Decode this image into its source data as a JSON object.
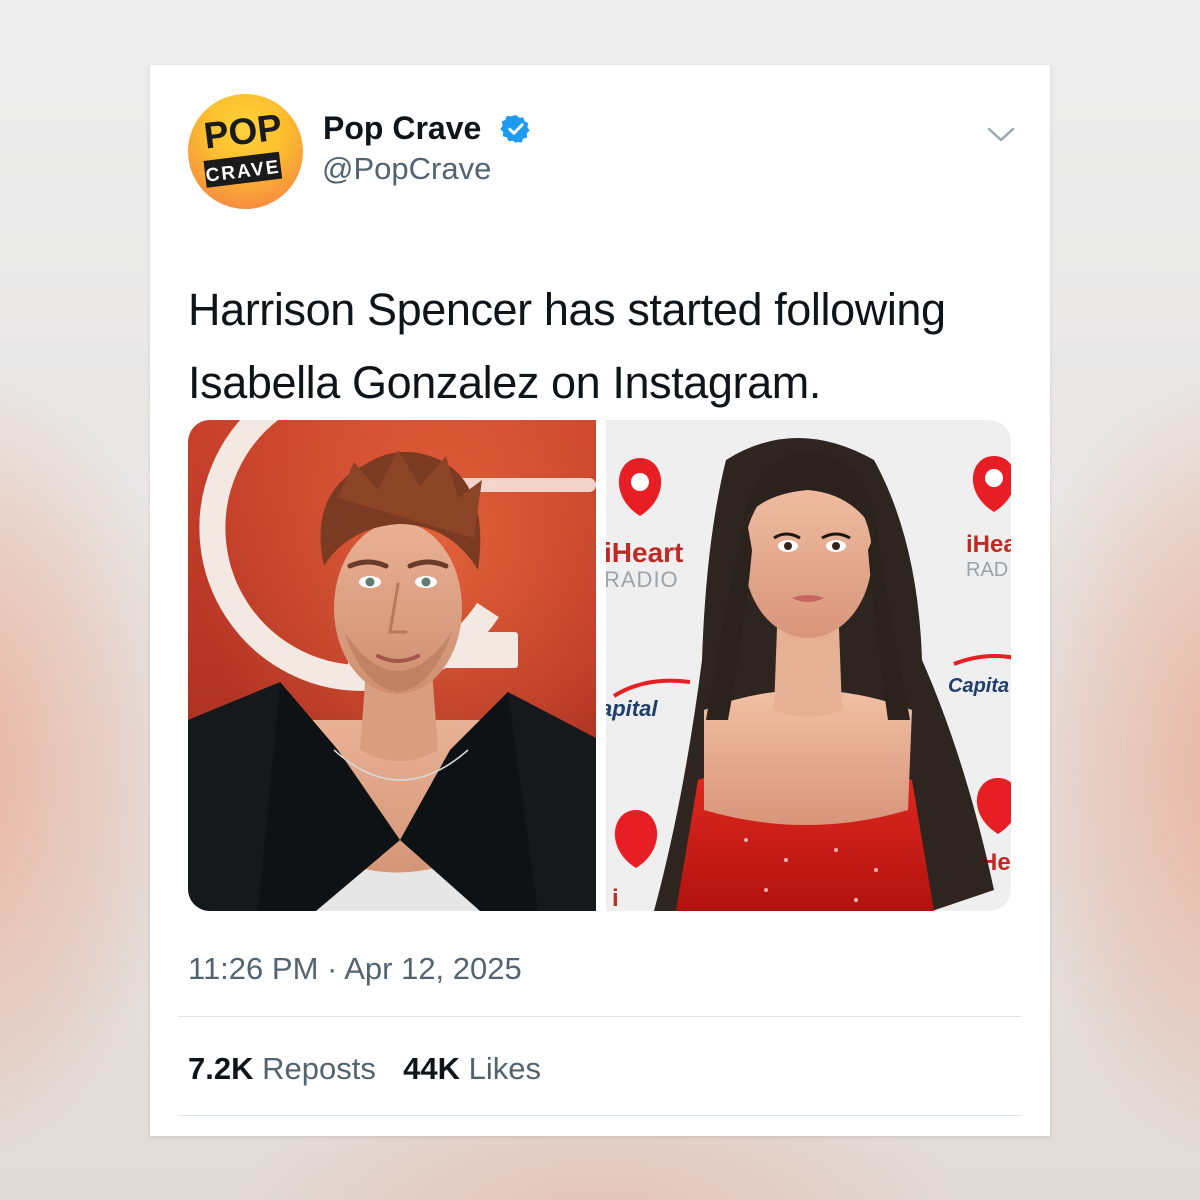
{
  "account": {
    "name": "Pop Crave",
    "handle": "@PopCrave",
    "avatar_text_top": "POP",
    "avatar_text_bottom": "CRAVE"
  },
  "tweet": {
    "text_line1": "Harrison Spencer has started following",
    "text_line2": "Isabella Gonzalez on Instagram."
  },
  "timestamp": "11:26 PM · Apr 12, 2025",
  "stats": {
    "reposts_count": "7.2K",
    "reposts_label": "Reposts",
    "likes_count": "44K",
    "likes_label": "Likes"
  },
  "media": {
    "backdrop_texts": {
      "left_iheart": "iHeart",
      "left_radio": "RADIO",
      "right_iheart": "iHea",
      "right_radio": "RAD",
      "capital_left": "apital",
      "capital_right": "Capita",
      "bottom_he": "He",
      "bottom_i": "i"
    }
  },
  "colors": {
    "accent_blue": "#1d9bf0",
    "text_primary": "#0f1419",
    "text_secondary": "#536471",
    "divider": "#dfe4e8",
    "iheart_red": "#e81e25",
    "pop_yellow": "#fcbf2e",
    "pop_orange": "#f47a45"
  },
  "icons": {
    "verified": "verified-badge-icon",
    "more": "chevron-down-icon"
  }
}
